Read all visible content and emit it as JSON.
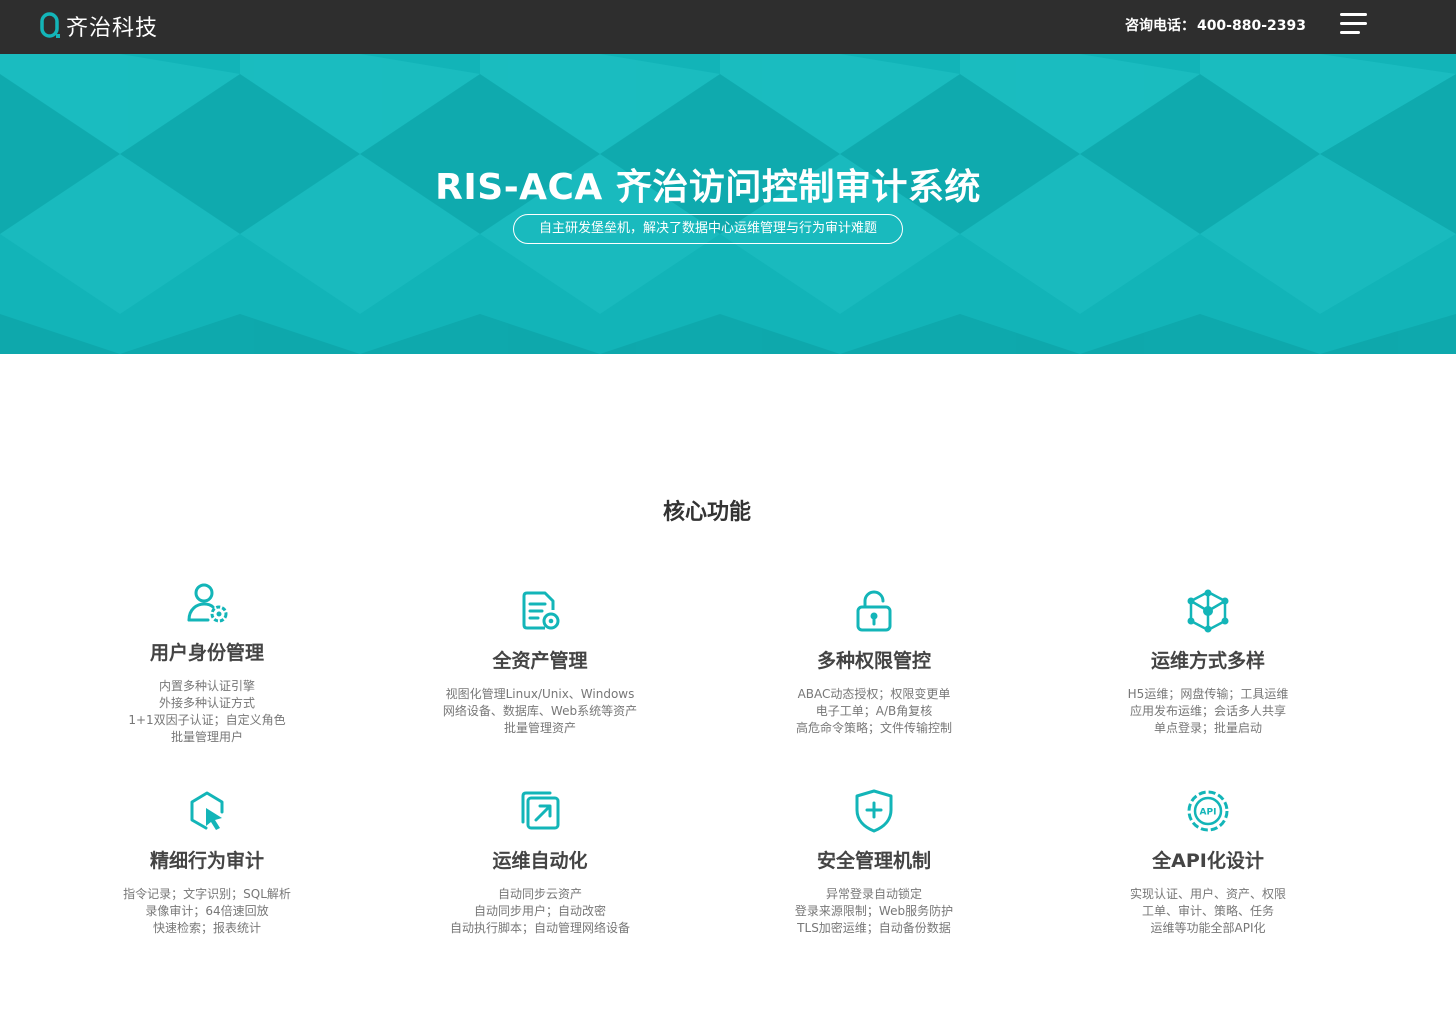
{
  "header": {
    "brand": "齐治科技",
    "hotline_label": "咨询电话：",
    "hotline_number": "400-880-2393",
    "menu_icon": "hamburger-menu-icon"
  },
  "hero": {
    "title": "RIS-ACA 齐治访问控制审计系统",
    "subtitle": "自主研发堡垒机，解决了数据中心运维管理与行为审计难题"
  },
  "section": {
    "title": "核心功能"
  },
  "features": [
    {
      "icon": "user-gear-icon",
      "title": "用户身份管理",
      "desc": [
        "内置多种认证引擎",
        "外接多种认证方式",
        "1+1双因子认证；自定义角色",
        "批量管理用户"
      ]
    },
    {
      "icon": "document-gear-icon",
      "title": "全资产管理",
      "desc": [
        "视图化管理Linux/Unix、Windows",
        "网络设备、数据库、Web系统等资产",
        "批量管理资产"
      ]
    },
    {
      "icon": "padlock-icon",
      "title": "多种权限管控",
      "desc": [
        "ABAC动态授权；权限变更单",
        "电子工单；A/B角复核",
        "高危命令策略；文件传输控制"
      ]
    },
    {
      "icon": "network-cube-icon",
      "title": "运维方式多样",
      "desc": [
        "H5运维；网盘传输；工具运维",
        "应用发布运维；会话多人共享",
        "单点登录；批量启动"
      ]
    },
    {
      "icon": "cursor-hexagon-icon",
      "title": "精细行为审计",
      "desc": [
        "指令记录；文字识别；SQL解析",
        "录像审计；64倍速回放",
        "快速检索；报表统计"
      ]
    },
    {
      "icon": "export-arrow-icon",
      "title": "运维自动化",
      "desc": [
        "自动同步云资产",
        "自动同步用户；自动改密",
        "自动执行脚本；自动管理网络设备"
      ]
    },
    {
      "icon": "shield-plus-icon",
      "title": "安全管理机制",
      "desc": [
        "异常登录自动锁定",
        "登录来源限制；Web服务防护",
        "TLS加密运维；自动备份数据"
      ]
    },
    {
      "icon": "api-gear-icon",
      "title": "全API化设计",
      "desc": [
        "实现认证、用户、资产、权限",
        "工单、审计、策略、任务",
        "运维等功能全部API化"
      ]
    }
  ],
  "colors": {
    "accent": "#13b5b8",
    "header_bg": "#2e2e2e",
    "hero_bg": "#12b4b8"
  }
}
